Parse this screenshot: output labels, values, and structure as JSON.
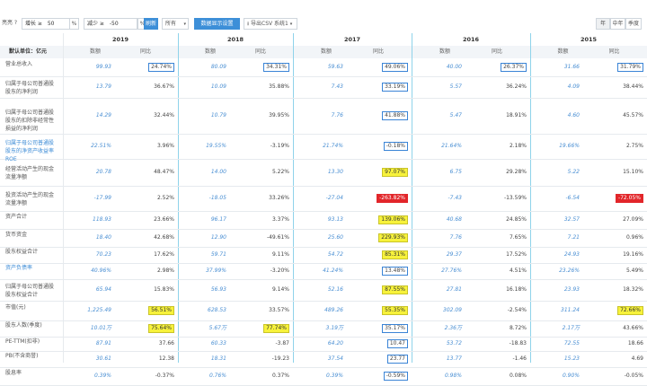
{
  "toolbar": {
    "title": "亮亮 ?",
    "filter1_label": "增长 ≥",
    "filter1_value": "50",
    "filter1_unit": "%",
    "filter2_label": "减少 ≥",
    "filter2_value": "-50",
    "filter2_unit": "%",
    "apply_label": "刷新",
    "period_select": "所有",
    "settings_label": "数据显示设置",
    "export_label": "导出CSV 系统1",
    "view_year": "年",
    "view_mid": "中年",
    "view_quarter": "季度"
  },
  "table": {
    "corner_label": "默认单位：亿元",
    "years": [
      "2019",
      "2018",
      "2017",
      "2016",
      "2015"
    ],
    "col_value_label": "数额",
    "col_yoy_label": "同比",
    "rows": [
      {
        "label": "营业总收入",
        "vals": [
          [
            "99.93",
            "24.74%"
          ],
          [
            "80.09",
            "34.31%"
          ],
          [
            "59.63",
            "49.06%"
          ],
          [
            "40.00",
            "26.37%"
          ],
          [
            "31.66",
            "31.79%"
          ]
        ]
      },
      {
        "label": "归属于母公司普通股股东的净利润",
        "vals": [
          [
            "13.79",
            "36.67%"
          ],
          [
            "10.09",
            "35.88%"
          ],
          [
            "7.43",
            "33.19%"
          ],
          [
            "5.57",
            "36.24%"
          ],
          [
            "4.09",
            "38.44%"
          ]
        ]
      },
      {
        "label": "归属于母公司普通股股东的扣除非经常性损益的净利润",
        "vals": [
          [
            "14.29",
            "32.44%"
          ],
          [
            "10.79",
            "39.95%"
          ],
          [
            "7.76",
            "41.88%"
          ],
          [
            "5.47",
            "18.91%"
          ],
          [
            "4.60",
            "45.57%"
          ]
        ]
      },
      {
        "label": "归属于母公司普通股股东的净资产收益率ROE",
        "vals": [
          [
            "22.51%",
            "3.96%"
          ],
          [
            "19.55%",
            "-3.19%"
          ],
          [
            "21.74%",
            "-0.18%"
          ],
          [
            "21.64%",
            "2.18%"
          ],
          [
            "19.66%",
            "2.75%"
          ]
        ]
      },
      {
        "label": "经营活动产生的现金流量净额",
        "vals": [
          [
            "20.78",
            "48.47%"
          ],
          [
            "14.00",
            "5.22%"
          ],
          [
            "13.30",
            "97.07%"
          ],
          [
            "6.75",
            "29.28%"
          ],
          [
            "5.22",
            "15.10%"
          ]
        ]
      },
      {
        "label": "投资活动产生的现金流量净额",
        "vals": [
          [
            "-17.99",
            "2.52%"
          ],
          [
            "-18.05",
            "33.26%"
          ],
          [
            "-27.04",
            "-263.82%"
          ],
          [
            "-7.43",
            "-13.59%"
          ],
          [
            "-6.54",
            "-72.05%"
          ]
        ]
      },
      {
        "label": "资产合计",
        "vals": [
          [
            "118.93",
            "23.66%"
          ],
          [
            "96.17",
            "3.37%"
          ],
          [
            "93.13",
            "139.06%"
          ],
          [
            "40.68",
            "24.85%"
          ],
          [
            "32.57",
            "27.09%"
          ]
        ]
      },
      {
        "label": "货币资金",
        "vals": [
          [
            "18.40",
            "42.68%"
          ],
          [
            "12.90",
            "-49.61%"
          ],
          [
            "25.60",
            "229.93%"
          ],
          [
            "7.76",
            "7.65%"
          ],
          [
            "7.21",
            "0.96%"
          ]
        ]
      },
      {
        "label": "股东权益合计",
        "vals": [
          [
            "70.23",
            "17.62%"
          ],
          [
            "59.71",
            "9.11%"
          ],
          [
            "54.72",
            "85.31%"
          ],
          [
            "29.37",
            "17.52%"
          ],
          [
            "24.93",
            "19.16%"
          ]
        ]
      },
      {
        "label": "资产负债率",
        "vals": [
          [
            "40.96%",
            "2.98%"
          ],
          [
            "37.99%",
            "-3.20%"
          ],
          [
            "41.24%",
            "13.48%"
          ],
          [
            "27.76%",
            "4.51%"
          ],
          [
            "23.26%",
            "5.49%"
          ]
        ]
      },
      {
        "label": "归属于母公司普通股股东权益合计",
        "vals": [
          [
            "65.94",
            "15.83%"
          ],
          [
            "56.93",
            "9.14%"
          ],
          [
            "52.16",
            "87.55%"
          ],
          [
            "27.81",
            "16.18%"
          ],
          [
            "23.93",
            "18.32%"
          ]
        ]
      },
      {
        "label": "市值(元)",
        "vals": [
          [
            "1,225.49",
            "56.51%"
          ],
          [
            "628.53",
            "33.57%"
          ],
          [
            "489.26",
            "55.35%"
          ],
          [
            "302.09",
            "-2.54%"
          ],
          [
            "311.24",
            "72.66%"
          ]
        ]
      },
      {
        "label": "股东人数(季度)",
        "vals": [
          [
            "10.01万",
            "75.64%"
          ],
          [
            "5.67万",
            "77.74%"
          ],
          [
            "3.19万",
            "35.17%"
          ],
          [
            "2.36万",
            "8.72%"
          ],
          [
            "2.17万",
            "43.66%"
          ]
        ]
      },
      {
        "label": "PE-TTM(扣非)",
        "vals": [
          [
            "87.91",
            "37.66"
          ],
          [
            "60.33",
            "-3.87"
          ],
          [
            "64.20",
            "10.47"
          ],
          [
            "53.72",
            "-18.83"
          ],
          [
            "72.55",
            "18.66"
          ]
        ]
      },
      {
        "label": "PB(不含商誉)",
        "vals": [
          [
            "30.61",
            "12.38"
          ],
          [
            "18.31",
            "-19.23"
          ],
          [
            "37.54",
            "23.77"
          ],
          [
            "13.77",
            "-1.46"
          ],
          [
            "15.23",
            "4.69"
          ]
        ]
      },
      {
        "label": "股息率",
        "vals": [
          [
            "0.39%",
            "-0.37%"
          ],
          [
            "0.76%",
            "0.37%"
          ],
          [
            "0.39%",
            "-0.59%"
          ],
          [
            "0.98%",
            "0.08%"
          ],
          [
            "0.90%",
            "-0.05%"
          ]
        ]
      }
    ]
  }
}
